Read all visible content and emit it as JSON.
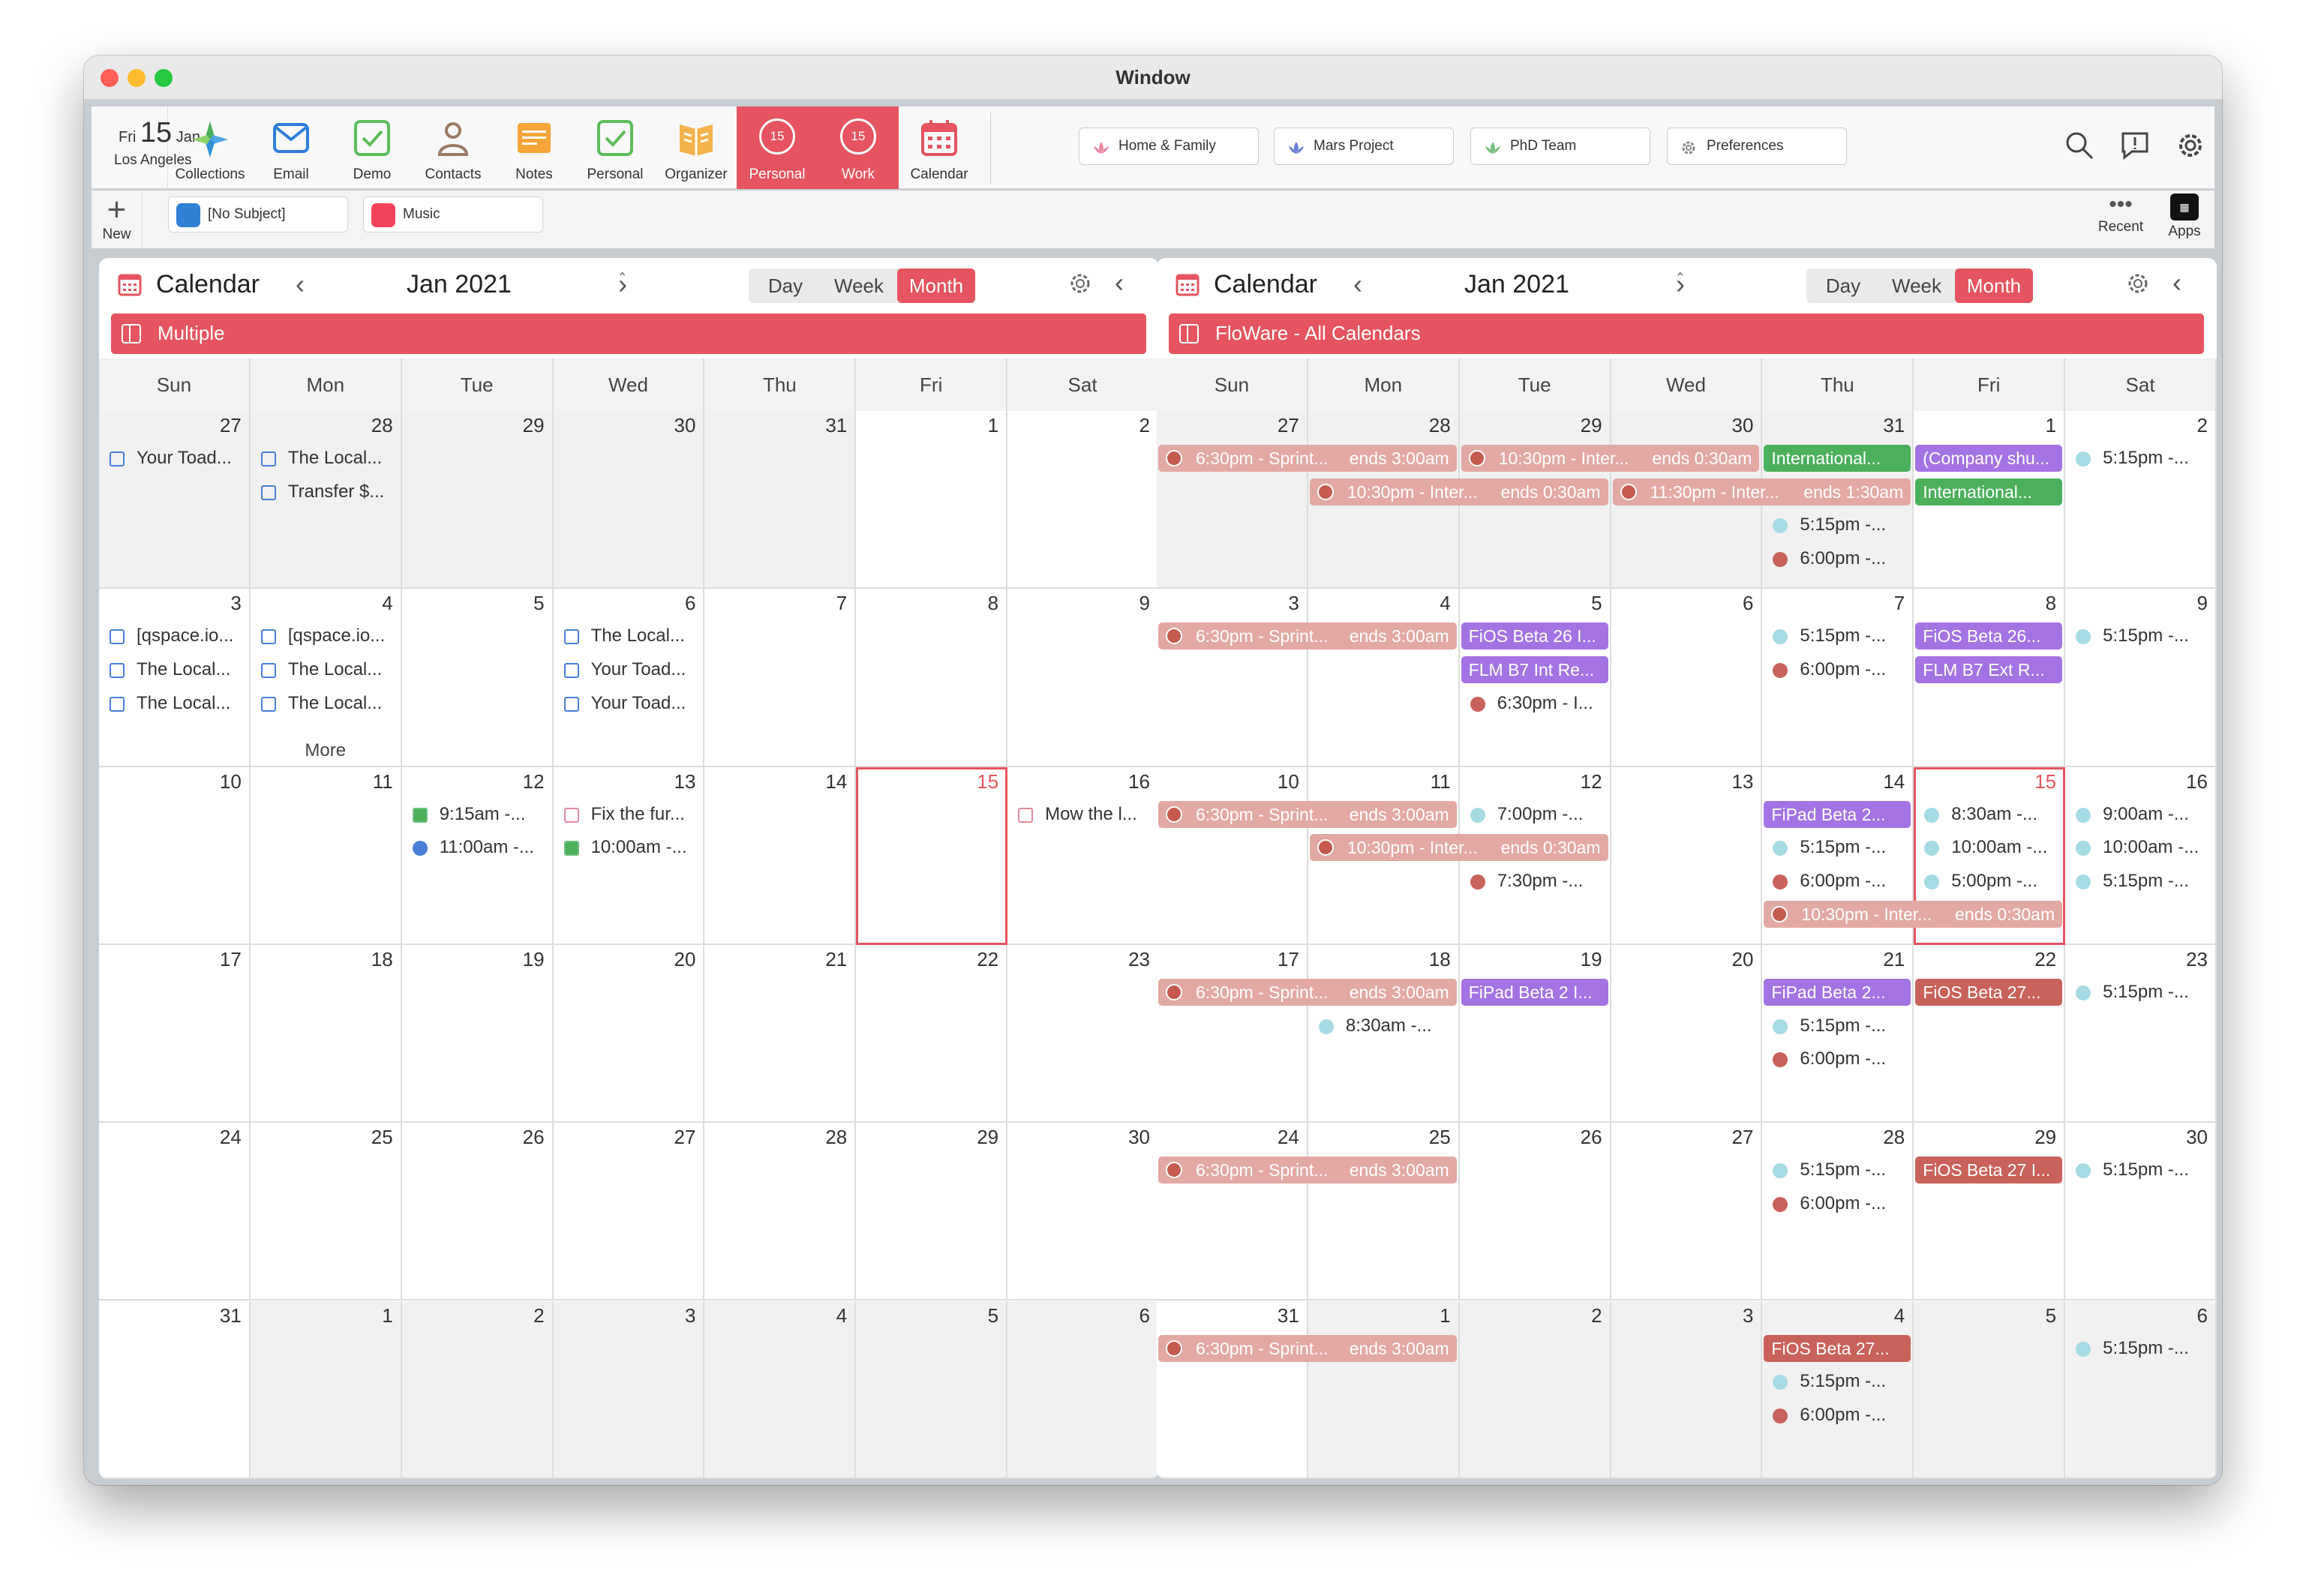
{
  "window": {
    "title": "Window"
  },
  "toolbar": {
    "date": {
      "weekday": "Fri",
      "day": "15",
      "month": "Jan",
      "city": "Los Angeles"
    },
    "buttons": [
      {
        "label": "Collections",
        "icon": "collections-icon"
      },
      {
        "label": "Email",
        "icon": "email-icon"
      },
      {
        "label": "Demo",
        "icon": "checkbox-icon"
      },
      {
        "label": "Contacts",
        "icon": "contacts-icon"
      },
      {
        "label": "Notes",
        "icon": "notes-icon"
      },
      {
        "label": "Personal",
        "icon": "checkbox-icon"
      },
      {
        "label": "Organizer",
        "icon": "organizer-icon"
      },
      {
        "label": "Personal",
        "icon": "calendar-badge-icon",
        "badge": "15",
        "active": true
      },
      {
        "label": "Work",
        "icon": "calendar-badge-icon",
        "badge": "15",
        "active": true
      },
      {
        "label": "Calendar",
        "icon": "calendar-icon"
      }
    ],
    "collections": [
      {
        "label": "Home & Family",
        "color": "#e88aa0"
      },
      {
        "label": "Mars Project",
        "color": "#6a7fd8"
      },
      {
        "label": "PhD Team",
        "color": "#7bbf7f"
      },
      {
        "label": "Preferences",
        "color": "#888888"
      }
    ]
  },
  "row2": {
    "new_label": "New",
    "tabs": [
      "[No Subject]",
      "Music"
    ],
    "recent_label": "Recent",
    "apps_label": "Apps"
  },
  "left": {
    "title": "Calendar",
    "month": "Jan 2021",
    "views": {
      "day": "Day",
      "week": "Week",
      "month": "Month"
    },
    "calendar_name": "Multiple",
    "days": [
      "Sun",
      "Mon",
      "Tue",
      "Wed",
      "Thu",
      "Fri",
      "Sat"
    ],
    "weeks": [
      [
        "27",
        "28",
        "29",
        "30",
        "31",
        "1",
        "2"
      ],
      [
        "3",
        "4",
        "5",
        "6",
        "7",
        "8",
        "9"
      ],
      [
        "10",
        "11",
        "12",
        "13",
        "14",
        "15",
        "16"
      ],
      [
        "17",
        "18",
        "19",
        "20",
        "21",
        "22",
        "23"
      ],
      [
        "24",
        "25",
        "26",
        "27",
        "28",
        "29",
        "30"
      ],
      [
        "31",
        "1",
        "2",
        "3",
        "4",
        "5",
        "6"
      ]
    ],
    "events": [
      {
        "w": 0,
        "d": 0,
        "slot": 0,
        "text": "Your Toad...",
        "kind": "check"
      },
      {
        "w": 0,
        "d": 1,
        "slot": 0,
        "text": "The Local...",
        "kind": "check"
      },
      {
        "w": 0,
        "d": 1,
        "slot": 1,
        "text": "Transfer $...",
        "kind": "check"
      },
      {
        "w": 1,
        "d": 0,
        "slot": 0,
        "text": "[qspace.io...",
        "kind": "check"
      },
      {
        "w": 1,
        "d": 0,
        "slot": 1,
        "text": "The Local...",
        "kind": "check"
      },
      {
        "w": 1,
        "d": 0,
        "slot": 2,
        "text": "The Local...",
        "kind": "check"
      },
      {
        "w": 1,
        "d": 1,
        "slot": 0,
        "text": "[qspace.io...",
        "kind": "check"
      },
      {
        "w": 1,
        "d": 1,
        "slot": 1,
        "text": "The Local...",
        "kind": "check"
      },
      {
        "w": 1,
        "d": 1,
        "slot": 2,
        "text": "The Local...",
        "kind": "check"
      },
      {
        "w": 1,
        "d": 3,
        "slot": 0,
        "text": "The Local...",
        "kind": "check"
      },
      {
        "w": 1,
        "d": 3,
        "slot": 1,
        "text": "Your Toad...",
        "kind": "check"
      },
      {
        "w": 1,
        "d": 3,
        "slot": 2,
        "text": "Your Toad...",
        "kind": "check"
      },
      {
        "w": 2,
        "d": 2,
        "slot": 0,
        "text": "9:15am -...",
        "kind": "check-green"
      },
      {
        "w": 2,
        "d": 2,
        "slot": 1,
        "text": "11:00am -...",
        "kind": "dot",
        "color": "#4a7fd8"
      },
      {
        "w": 2,
        "d": 3,
        "slot": 0,
        "text": "Fix the fur...",
        "kind": "check-pink"
      },
      {
        "w": 2,
        "d": 3,
        "slot": 1,
        "text": "10:00am -...",
        "kind": "check-green"
      },
      {
        "w": 2,
        "d": 6,
        "slot": 0,
        "text": "Mow the l...",
        "kind": "check-pink"
      }
    ],
    "more": {
      "w": 1,
      "d": 1,
      "text": "More"
    }
  },
  "right": {
    "title": "Calendar",
    "month": "Jan 2021",
    "views": {
      "day": "Day",
      "week": "Week",
      "month": "Month"
    },
    "calendar_name": "FloWare - All Calendars",
    "days": [
      "Sun",
      "Mon",
      "Tue",
      "Wed",
      "Thu",
      "Fri",
      "Sat"
    ],
    "weeks": [
      [
        "27",
        "28",
        "29",
        "30",
        "31",
        "1",
        "2"
      ],
      [
        "3",
        "4",
        "5",
        "6",
        "7",
        "8",
        "9"
      ],
      [
        "10",
        "11",
        "12",
        "13",
        "14",
        "15",
        "16"
      ],
      [
        "17",
        "18",
        "19",
        "20",
        "21",
        "22",
        "23"
      ],
      [
        "24",
        "25",
        "26",
        "27",
        "28",
        "29",
        "30"
      ],
      [
        "31",
        "1",
        "2",
        "3",
        "4",
        "5",
        "6"
      ]
    ],
    "bars": [
      {
        "w": 0,
        "d": 0,
        "span": 2,
        "slot": 0,
        "text": "6:30pm - Sprint...",
        "ends": "ends 3:00am",
        "kind": "sprint"
      },
      {
        "w": 0,
        "d": 2,
        "span": 2,
        "slot": 0,
        "text": "10:30pm - Inter...",
        "ends": "ends 0:30am",
        "kind": "sprint"
      },
      {
        "w": 0,
        "d": 4,
        "span": 1,
        "slot": 0,
        "text": "International...",
        "kind": "green"
      },
      {
        "w": 0,
        "d": 5,
        "span": 1,
        "slot": 0,
        "text": "(Company shu...",
        "kind": "purple"
      },
      {
        "w": 0,
        "d": 1,
        "span": 2,
        "slot": 1,
        "text": "10:30pm - Inter...",
        "ends": "ends 0:30am",
        "kind": "sprint"
      },
      {
        "w": 0,
        "d": 3,
        "span": 2,
        "slot": 1,
        "text": "11:30pm - Inter...",
        "ends": "ends 1:30am",
        "kind": "sprint"
      },
      {
        "w": 0,
        "d": 5,
        "span": 1,
        "slot": 1,
        "text": "International...",
        "kind": "green"
      },
      {
        "w": 1,
        "d": 0,
        "span": 2,
        "slot": 0,
        "text": "6:30pm - Sprint...",
        "ends": "ends 3:00am",
        "kind": "sprint"
      },
      {
        "w": 1,
        "d": 2,
        "span": 1,
        "slot": 0,
        "text": "FiOS Beta 26 I...",
        "kind": "purple"
      },
      {
        "w": 1,
        "d": 2,
        "span": 1,
        "slot": 1,
        "text": "FLM B7 Int Re...",
        "kind": "purple"
      },
      {
        "w": 1,
        "d": 5,
        "span": 1,
        "slot": 0,
        "text": "FiOS Beta 26...",
        "kind": "purple"
      },
      {
        "w": 1,
        "d": 5,
        "span": 1,
        "slot": 1,
        "text": "FLM B7 Ext R...",
        "kind": "purple"
      },
      {
        "w": 2,
        "d": 0,
        "span": 2,
        "slot": 0,
        "text": "6:30pm - Sprint...",
        "ends": "ends 3:00am",
        "kind": "sprint"
      },
      {
        "w": 2,
        "d": 1,
        "span": 2,
        "slot": 1,
        "text": "10:30pm - Inter...",
        "ends": "ends 0:30am",
        "kind": "sprint"
      },
      {
        "w": 2,
        "d": 4,
        "span": 1,
        "slot": 0,
        "text": "FiPad Beta 2...",
        "kind": "purple"
      },
      {
        "w": 2,
        "d": 4,
        "span": 2,
        "slot": 3,
        "text": "10:30pm - Inter...",
        "ends": "ends 0:30am",
        "kind": "sprint"
      },
      {
        "w": 3,
        "d": 0,
        "span": 2,
        "slot": 0,
        "text": "6:30pm - Sprint...",
        "ends": "ends 3:00am",
        "kind": "sprint"
      },
      {
        "w": 3,
        "d": 2,
        "span": 1,
        "slot": 0,
        "text": "FiPad Beta 2 I...",
        "kind": "purple"
      },
      {
        "w": 3,
        "d": 4,
        "span": 1,
        "slot": 0,
        "text": "FiPad Beta 2...",
        "kind": "purple"
      },
      {
        "w": 3,
        "d": 5,
        "span": 1,
        "slot": 0,
        "text": "FiOS Beta 27...",
        "kind": "red"
      },
      {
        "w": 4,
        "d": 0,
        "span": 2,
        "slot": 0,
        "text": "6:30pm - Sprint...",
        "ends": "ends 3:00am",
        "kind": "sprint"
      },
      {
        "w": 4,
        "d": 5,
        "span": 1,
        "slot": 0,
        "text": "FiOS Beta 27 I...",
        "kind": "red"
      },
      {
        "w": 5,
        "d": 0,
        "span": 2,
        "slot": 0,
        "text": "6:30pm - Sprint...",
        "ends": "ends 3:00am",
        "kind": "sprint"
      },
      {
        "w": 5,
        "d": 4,
        "span": 1,
        "slot": 0,
        "text": "FiOS Beta 27...",
        "kind": "red"
      }
    ],
    "dots": [
      {
        "w": 0,
        "d": 6,
        "slot": 0,
        "text": "5:15pm -...",
        "color": "#a6dbe3"
      },
      {
        "w": 0,
        "d": 4,
        "slot": 2,
        "text": "5:15pm -...",
        "color": "#a6dbe3"
      },
      {
        "w": 0,
        "d": 4,
        "slot": 3,
        "text": "6:00pm -...",
        "color": "#c9625a"
      },
      {
        "w": 1,
        "d": 2,
        "slot": 2,
        "text": "6:30pm - I...",
        "color": "#c9625a"
      },
      {
        "w": 1,
        "d": 4,
        "slot": 0,
        "text": "5:15pm -...",
        "color": "#a6dbe3"
      },
      {
        "w": 1,
        "d": 4,
        "slot": 1,
        "text": "6:00pm -...",
        "color": "#c9625a"
      },
      {
        "w": 1,
        "d": 6,
        "slot": 0,
        "text": "5:15pm -...",
        "color": "#a6dbe3"
      },
      {
        "w": 2,
        "d": 2,
        "slot": 0,
        "text": "7:00pm -...",
        "color": "#a6dbe3"
      },
      {
        "w": 2,
        "d": 2,
        "slot": 2,
        "text": "7:30pm -...",
        "color": "#c9625a"
      },
      {
        "w": 2,
        "d": 4,
        "slot": 1,
        "text": "5:15pm -...",
        "color": "#a6dbe3"
      },
      {
        "w": 2,
        "d": 4,
        "slot": 2,
        "text": "6:00pm -...",
        "color": "#c9625a"
      },
      {
        "w": 2,
        "d": 5,
        "slot": 0,
        "text": "8:30am -...",
        "color": "#a6dbe3"
      },
      {
        "w": 2,
        "d": 5,
        "slot": 1,
        "text": "10:00am -...",
        "color": "#a6dbe3"
      },
      {
        "w": 2,
        "d": 5,
        "slot": 2,
        "text": "5:00pm -...",
        "color": "#a6dbe3"
      },
      {
        "w": 2,
        "d": 6,
        "slot": 0,
        "text": "9:00am -...",
        "color": "#a6dbe3"
      },
      {
        "w": 2,
        "d": 6,
        "slot": 1,
        "text": "10:00am -...",
        "color": "#a6dbe3"
      },
      {
        "w": 2,
        "d": 6,
        "slot": 2,
        "text": "5:15pm -...",
        "color": "#a6dbe3"
      },
      {
        "w": 3,
        "d": 1,
        "slot": 1,
        "text": "8:30am -...",
        "color": "#a6dbe3"
      },
      {
        "w": 3,
        "d": 4,
        "slot": 1,
        "text": "5:15pm -...",
        "color": "#a6dbe3"
      },
      {
        "w": 3,
        "d": 4,
        "slot": 2,
        "text": "6:00pm -...",
        "color": "#c9625a"
      },
      {
        "w": 3,
        "d": 6,
        "slot": 0,
        "text": "5:15pm -...",
        "color": "#a6dbe3"
      },
      {
        "w": 4,
        "d": 4,
        "slot": 0,
        "text": "5:15pm -...",
        "color": "#a6dbe3"
      },
      {
        "w": 4,
        "d": 4,
        "slot": 1,
        "text": "6:00pm -...",
        "color": "#c9625a"
      },
      {
        "w": 4,
        "d": 6,
        "slot": 0,
        "text": "5:15pm -...",
        "color": "#a6dbe3"
      },
      {
        "w": 5,
        "d": 4,
        "slot": 1,
        "text": "5:15pm -...",
        "color": "#a6dbe3"
      },
      {
        "w": 5,
        "d": 4,
        "slot": 2,
        "text": "6:00pm -...",
        "color": "#c9625a"
      },
      {
        "w": 5,
        "d": 6,
        "slot": 0,
        "text": "5:15pm -...",
        "color": "#a6dbe3"
      }
    ]
  },
  "colors": {
    "accent": "#e5545f"
  }
}
